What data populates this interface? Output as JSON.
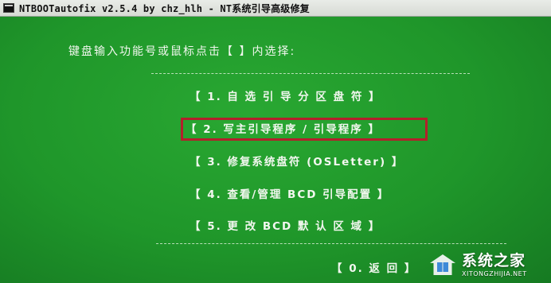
{
  "window": {
    "title": "NTBOOTautofix v2.5.4 by chz_hlh - NT系统引导高级修复"
  },
  "prompt": "键盘输入功能号或鼠标点击【 】内选择:",
  "menu": [
    {
      "label": "【 1. 自 选 引 导 分 区 盘 符 】"
    },
    {
      "label": "【 2. 写主引导程序 / 引导程序 】"
    },
    {
      "label": "【 3. 修复系统盘符 (OSLetter) 】"
    },
    {
      "label": "【 4. 查看/管理 BCD 引导配置 】"
    },
    {
      "label": "【 5. 更 改 BCD 默 认 区 域 】"
    },
    {
      "label": "【 0. 返 回 】"
    }
  ],
  "highlighted_item": 2,
  "watermark": {
    "name": "系统之家",
    "url": "XITONGZHIJIA.NET"
  },
  "colors": {
    "background": "#1f962a",
    "text": "#f2f7ef",
    "highlight_border": "#b3202b"
  }
}
